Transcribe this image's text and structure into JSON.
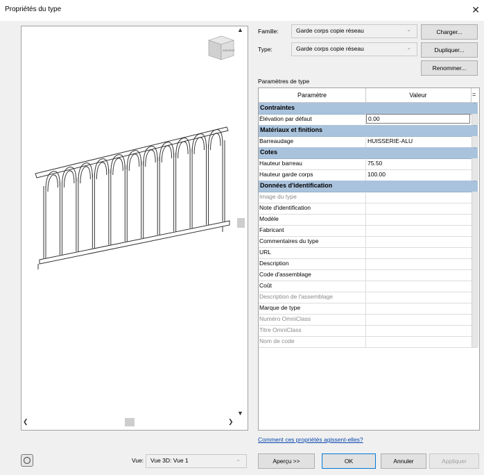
{
  "window": {
    "title": "Propriétés du type",
    "close": "✕"
  },
  "preview": {
    "viewcube_label": "ARRIÈRE",
    "scroll_up": "▲",
    "scroll_down": "▼",
    "scroll_left": "❮",
    "scroll_right": "❯"
  },
  "family": {
    "label": "Famille:",
    "value": "Garde corps copie réseau"
  },
  "type": {
    "label": "Type:",
    "value": "Garde corps copie réseau"
  },
  "buttons": {
    "load": "Charger...",
    "duplicate": "Dupliquer...",
    "rename": "Renommer..."
  },
  "params_title": "Paramètres de type",
  "grid": {
    "col_param": "Paramètre",
    "col_value": "Valeur",
    "col_extra": "=",
    "rows": [
      {
        "kind": "group",
        "label": "Contraintes"
      },
      {
        "kind": "row",
        "label": "Élévation par défaut",
        "value": "0.00",
        "dim": false,
        "edit": true
      },
      {
        "kind": "group",
        "label": "Matériaux et finitions"
      },
      {
        "kind": "row",
        "label": "Barreaudage",
        "value": "HUISSERIE-ALU",
        "dim": false
      },
      {
        "kind": "group",
        "label": "Cotes"
      },
      {
        "kind": "row",
        "label": "Hauteur barreau",
        "value": "75.50",
        "dim": false
      },
      {
        "kind": "row",
        "label": "Hauteur garde corps",
        "value": "100.00",
        "dim": false
      },
      {
        "kind": "group",
        "label": "Données d'identification"
      },
      {
        "kind": "row",
        "label": "Image du type",
        "value": "",
        "dim": true
      },
      {
        "kind": "row",
        "label": "Note d'identification",
        "value": "",
        "dim": false
      },
      {
        "kind": "row",
        "label": "Modèle",
        "value": "",
        "dim": false
      },
      {
        "kind": "row",
        "label": "Fabricant",
        "value": "",
        "dim": false
      },
      {
        "kind": "row",
        "label": "Commentaires du type",
        "value": "",
        "dim": false
      },
      {
        "kind": "row",
        "label": "URL",
        "value": "",
        "dim": false
      },
      {
        "kind": "row",
        "label": "Description",
        "value": "",
        "dim": false
      },
      {
        "kind": "row",
        "label": "Code d'assemblage",
        "value": "",
        "dim": false
      },
      {
        "kind": "row",
        "label": "Coût",
        "value": "",
        "dim": false
      },
      {
        "kind": "row",
        "label": "Description de l'assemblage",
        "value": "",
        "dim": true
      },
      {
        "kind": "row",
        "label": "Marque de type",
        "value": "",
        "dim": false
      },
      {
        "kind": "row",
        "label": "Numéro OmniClass",
        "value": "",
        "dim": true
      },
      {
        "kind": "row",
        "label": "Titre OmniClass",
        "value": "",
        "dim": true
      },
      {
        "kind": "row",
        "label": "Nom de code",
        "value": "",
        "dim": true
      }
    ]
  },
  "help_link": "Comment ces propriétés agissent-elles?",
  "footer": {
    "view_label": "Vue:",
    "view_value": "Vue 3D: Vue 1",
    "preview_btn": "Aperçu >>",
    "ok": "OK",
    "cancel": "Annuler",
    "apply": "Appliquer"
  }
}
